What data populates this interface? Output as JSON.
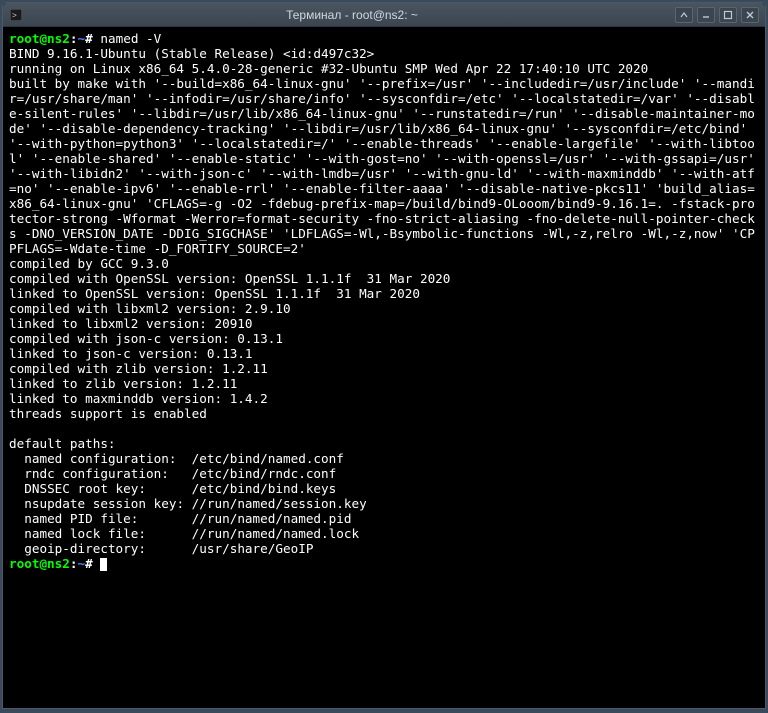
{
  "window": {
    "title": "Терминал - root@ns2: ~"
  },
  "prompt": {
    "user_host": "root@ns2",
    "colon": ":",
    "path": "~",
    "hash": "#"
  },
  "command": "named -V",
  "output": "BIND 9.16.1-Ubuntu (Stable Release) <id:d497c32>\nrunning on Linux x86_64 5.4.0-28-generic #32-Ubuntu SMP Wed Apr 22 17:40:10 UTC 2020\nbuilt by make with '--build=x86_64-linux-gnu' '--prefix=/usr' '--includedir=/usr/include' '--mandir=/usr/share/man' '--infodir=/usr/share/info' '--sysconfdir=/etc' '--localstatedir=/var' '--disable-silent-rules' '--libdir=/usr/lib/x86_64-linux-gnu' '--runstatedir=/run' '--disable-maintainer-mode' '--disable-dependency-tracking' '--libdir=/usr/lib/x86_64-linux-gnu' '--sysconfdir=/etc/bind' '--with-python=python3' '--localstatedir=/' '--enable-threads' '--enable-largefile' '--with-libtool' '--enable-shared' '--enable-static' '--with-gost=no' '--with-openssl=/usr' '--with-gssapi=/usr' '--with-libidn2' '--with-json-c' '--with-lmdb=/usr' '--with-gnu-ld' '--with-maxminddb' '--with-atf=no' '--enable-ipv6' '--enable-rrl' '--enable-filter-aaaa' '--disable-native-pkcs11' 'build_alias=x86_64-linux-gnu' 'CFLAGS=-g -O2 -fdebug-prefix-map=/build/bind9-OLooom/bind9-9.16.1=. -fstack-protector-strong -Wformat -Werror=format-security -fno-strict-aliasing -fno-delete-null-pointer-checks -DNO_VERSION_DATE -DDIG_SIGCHASE' 'LDFLAGS=-Wl,-Bsymbolic-functions -Wl,-z,relro -Wl,-z,now' 'CPPFLAGS=-Wdate-time -D_FORTIFY_SOURCE=2'\ncompiled by GCC 9.3.0\ncompiled with OpenSSL version: OpenSSL 1.1.1f  31 Mar 2020\nlinked to OpenSSL version: OpenSSL 1.1.1f  31 Mar 2020\ncompiled with libxml2 version: 2.9.10\nlinked to libxml2 version: 20910\ncompiled with json-c version: 0.13.1\nlinked to json-c version: 0.13.1\ncompiled with zlib version: 1.2.11\nlinked to zlib version: 1.2.11\nlinked to maxminddb version: 1.4.2\nthreads support is enabled\n\ndefault paths:\n  named configuration:  /etc/bind/named.conf\n  rndc configuration:   /etc/bind/rndc.conf\n  DNSSEC root key:      /etc/bind/bind.keys\n  nsupdate session key: //run/named/session.key\n  named PID file:       //run/named/named.pid\n  named lock file:      //run/named/named.lock\n  geoip-directory:      /usr/share/GeoIP"
}
